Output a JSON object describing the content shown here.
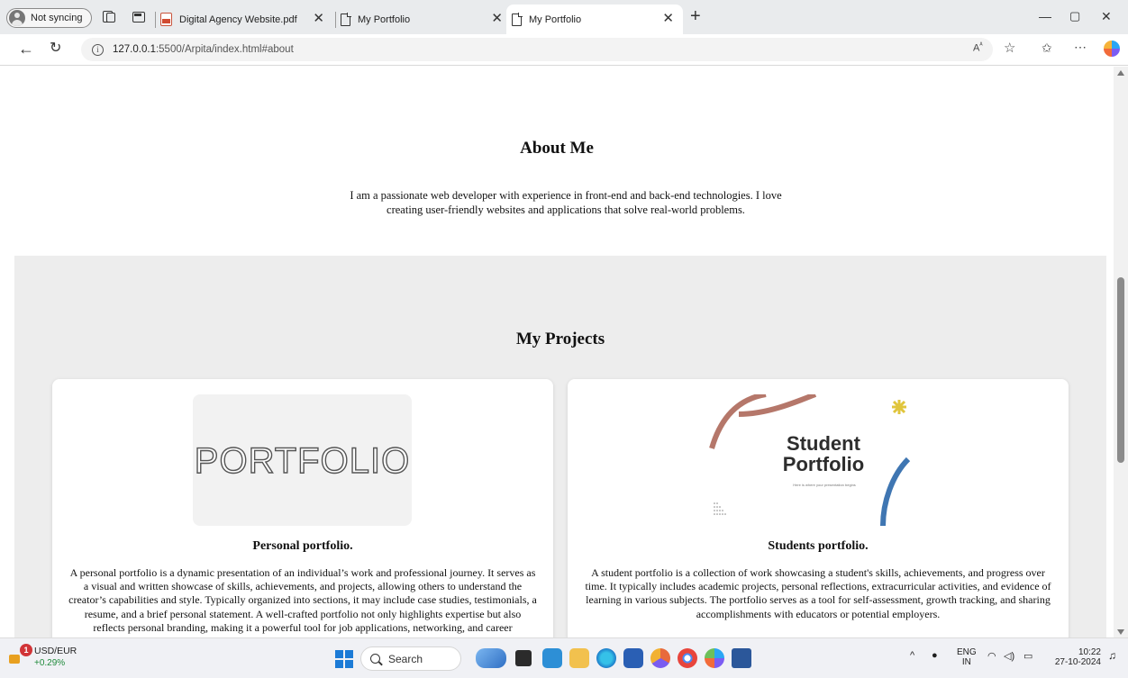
{
  "browser": {
    "profile_label": "Not syncing",
    "tabs": [
      {
        "title": "Digital Agency Website.pdf",
        "active": false
      },
      {
        "title": "My Portfolio",
        "active": false
      },
      {
        "title": "My Portfolio",
        "active": true
      }
    ],
    "url_host": "127.0.0.1",
    "url_rest": ":5500/Arpita/index.html#about"
  },
  "about": {
    "title": "About Me",
    "text": "I am a passionate web developer with experience in front-end and back-end technologies. I love creating user-friendly websites and applications that solve real-world problems."
  },
  "projects": {
    "title": "My Projects",
    "cards": [
      {
        "image_text": "PORTFOLIO",
        "title": "Personal portfolio.",
        "description": "A personal portfolio is a dynamic presentation of an individual’s work and professional journey. It serves as a visual and written showcase of skills, achievements, and projects, allowing others to understand the creator’s capabilities and style. Typically organized into sections, it may include case studies, testimonials, a resume, and a brief personal statement. A well-crafted portfolio not only highlights expertise but also reflects personal branding, making it a powerful tool for job applications, networking, and career advancement."
      },
      {
        "image_text": "Student Portfolio",
        "image_subtext": "Here is where your presentation begins",
        "title": "Students portfolio.",
        "description": "A student portfolio is a collection of work showcasing a student's skills, achievements, and progress over time. It typically includes academic projects, personal reflections, extracurricular activities, and evidence of learning in various subjects. The portfolio serves as a tool for self-assessment, growth tracking, and sharing accomplishments with educators or potential employers."
      }
    ]
  },
  "taskbar": {
    "ticker_name": "USD/EUR",
    "ticker_change": "+0.29%",
    "widget_badge": "1",
    "search_label": "Search",
    "lang_1": "ENG",
    "lang_2": "IN",
    "time": "10:22",
    "date": "27-10-2024"
  },
  "colors": {
    "accent": "#1c7bd6",
    "projects_bg": "#ededed",
    "ticker_up": "#1f8a3b"
  }
}
